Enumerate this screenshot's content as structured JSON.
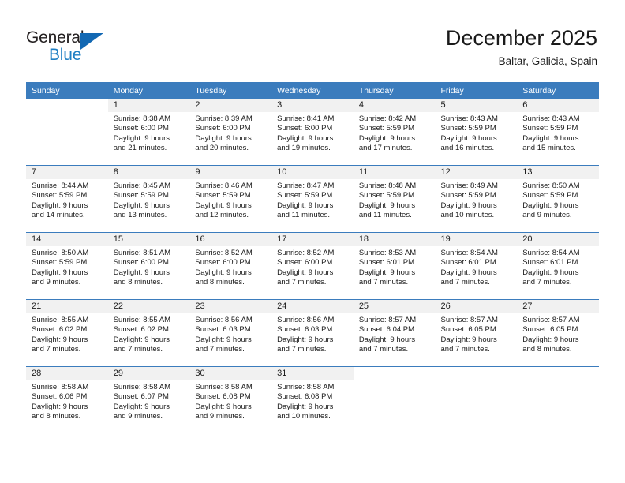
{
  "brand": {
    "name_part1": "General",
    "name_part2": "Blue",
    "triangle_icon": "triangle-icon",
    "accent_color": "#1f7fc4",
    "triangle_color": "#1268b3"
  },
  "header": {
    "title": "December 2025",
    "subtitle": "Baltar, Galicia, Spain"
  },
  "calendar": {
    "header_bg": "#3b7cbd",
    "daynum_bg": "#f1f1f1",
    "weekday_headers": [
      "Sunday",
      "Monday",
      "Tuesday",
      "Wednesday",
      "Thursday",
      "Friday",
      "Saturday"
    ],
    "weeks": [
      [
        {
          "day": "",
          "sunrise": "",
          "sunset": "",
          "daylight_line1": "",
          "daylight_line2": "",
          "blank": true
        },
        {
          "day": "1",
          "sunrise": "Sunrise: 8:38 AM",
          "sunset": "Sunset: 6:00 PM",
          "daylight_line1": "Daylight: 9 hours",
          "daylight_line2": "and 21 minutes."
        },
        {
          "day": "2",
          "sunrise": "Sunrise: 8:39 AM",
          "sunset": "Sunset: 6:00 PM",
          "daylight_line1": "Daylight: 9 hours",
          "daylight_line2": "and 20 minutes."
        },
        {
          "day": "3",
          "sunrise": "Sunrise: 8:41 AM",
          "sunset": "Sunset: 6:00 PM",
          "daylight_line1": "Daylight: 9 hours",
          "daylight_line2": "and 19 minutes."
        },
        {
          "day": "4",
          "sunrise": "Sunrise: 8:42 AM",
          "sunset": "Sunset: 5:59 PM",
          "daylight_line1": "Daylight: 9 hours",
          "daylight_line2": "and 17 minutes."
        },
        {
          "day": "5",
          "sunrise": "Sunrise: 8:43 AM",
          "sunset": "Sunset: 5:59 PM",
          "daylight_line1": "Daylight: 9 hours",
          "daylight_line2": "and 16 minutes."
        },
        {
          "day": "6",
          "sunrise": "Sunrise: 8:43 AM",
          "sunset": "Sunset: 5:59 PM",
          "daylight_line1": "Daylight: 9 hours",
          "daylight_line2": "and 15 minutes."
        }
      ],
      [
        {
          "day": "7",
          "sunrise": "Sunrise: 8:44 AM",
          "sunset": "Sunset: 5:59 PM",
          "daylight_line1": "Daylight: 9 hours",
          "daylight_line2": "and 14 minutes."
        },
        {
          "day": "8",
          "sunrise": "Sunrise: 8:45 AM",
          "sunset": "Sunset: 5:59 PM",
          "daylight_line1": "Daylight: 9 hours",
          "daylight_line2": "and 13 minutes."
        },
        {
          "day": "9",
          "sunrise": "Sunrise: 8:46 AM",
          "sunset": "Sunset: 5:59 PM",
          "daylight_line1": "Daylight: 9 hours",
          "daylight_line2": "and 12 minutes."
        },
        {
          "day": "10",
          "sunrise": "Sunrise: 8:47 AM",
          "sunset": "Sunset: 5:59 PM",
          "daylight_line1": "Daylight: 9 hours",
          "daylight_line2": "and 11 minutes."
        },
        {
          "day": "11",
          "sunrise": "Sunrise: 8:48 AM",
          "sunset": "Sunset: 5:59 PM",
          "daylight_line1": "Daylight: 9 hours",
          "daylight_line2": "and 11 minutes."
        },
        {
          "day": "12",
          "sunrise": "Sunrise: 8:49 AM",
          "sunset": "Sunset: 5:59 PM",
          "daylight_line1": "Daylight: 9 hours",
          "daylight_line2": "and 10 minutes."
        },
        {
          "day": "13",
          "sunrise": "Sunrise: 8:50 AM",
          "sunset": "Sunset: 5:59 PM",
          "daylight_line1": "Daylight: 9 hours",
          "daylight_line2": "and 9 minutes."
        }
      ],
      [
        {
          "day": "14",
          "sunrise": "Sunrise: 8:50 AM",
          "sunset": "Sunset: 5:59 PM",
          "daylight_line1": "Daylight: 9 hours",
          "daylight_line2": "and 9 minutes."
        },
        {
          "day": "15",
          "sunrise": "Sunrise: 8:51 AM",
          "sunset": "Sunset: 6:00 PM",
          "daylight_line1": "Daylight: 9 hours",
          "daylight_line2": "and 8 minutes."
        },
        {
          "day": "16",
          "sunrise": "Sunrise: 8:52 AM",
          "sunset": "Sunset: 6:00 PM",
          "daylight_line1": "Daylight: 9 hours",
          "daylight_line2": "and 8 minutes."
        },
        {
          "day": "17",
          "sunrise": "Sunrise: 8:52 AM",
          "sunset": "Sunset: 6:00 PM",
          "daylight_line1": "Daylight: 9 hours",
          "daylight_line2": "and 7 minutes."
        },
        {
          "day": "18",
          "sunrise": "Sunrise: 8:53 AM",
          "sunset": "Sunset: 6:01 PM",
          "daylight_line1": "Daylight: 9 hours",
          "daylight_line2": "and 7 minutes."
        },
        {
          "day": "19",
          "sunrise": "Sunrise: 8:54 AM",
          "sunset": "Sunset: 6:01 PM",
          "daylight_line1": "Daylight: 9 hours",
          "daylight_line2": "and 7 minutes."
        },
        {
          "day": "20",
          "sunrise": "Sunrise: 8:54 AM",
          "sunset": "Sunset: 6:01 PM",
          "daylight_line1": "Daylight: 9 hours",
          "daylight_line2": "and 7 minutes."
        }
      ],
      [
        {
          "day": "21",
          "sunrise": "Sunrise: 8:55 AM",
          "sunset": "Sunset: 6:02 PM",
          "daylight_line1": "Daylight: 9 hours",
          "daylight_line2": "and 7 minutes."
        },
        {
          "day": "22",
          "sunrise": "Sunrise: 8:55 AM",
          "sunset": "Sunset: 6:02 PM",
          "daylight_line1": "Daylight: 9 hours",
          "daylight_line2": "and 7 minutes."
        },
        {
          "day": "23",
          "sunrise": "Sunrise: 8:56 AM",
          "sunset": "Sunset: 6:03 PM",
          "daylight_line1": "Daylight: 9 hours",
          "daylight_line2": "and 7 minutes."
        },
        {
          "day": "24",
          "sunrise": "Sunrise: 8:56 AM",
          "sunset": "Sunset: 6:03 PM",
          "daylight_line1": "Daylight: 9 hours",
          "daylight_line2": "and 7 minutes."
        },
        {
          "day": "25",
          "sunrise": "Sunrise: 8:57 AM",
          "sunset": "Sunset: 6:04 PM",
          "daylight_line1": "Daylight: 9 hours",
          "daylight_line2": "and 7 minutes."
        },
        {
          "day": "26",
          "sunrise": "Sunrise: 8:57 AM",
          "sunset": "Sunset: 6:05 PM",
          "daylight_line1": "Daylight: 9 hours",
          "daylight_line2": "and 7 minutes."
        },
        {
          "day": "27",
          "sunrise": "Sunrise: 8:57 AM",
          "sunset": "Sunset: 6:05 PM",
          "daylight_line1": "Daylight: 9 hours",
          "daylight_line2": "and 8 minutes."
        }
      ],
      [
        {
          "day": "28",
          "sunrise": "Sunrise: 8:58 AM",
          "sunset": "Sunset: 6:06 PM",
          "daylight_line1": "Daylight: 9 hours",
          "daylight_line2": "and 8 minutes."
        },
        {
          "day": "29",
          "sunrise": "Sunrise: 8:58 AM",
          "sunset": "Sunset: 6:07 PM",
          "daylight_line1": "Daylight: 9 hours",
          "daylight_line2": "and 9 minutes."
        },
        {
          "day": "30",
          "sunrise": "Sunrise: 8:58 AM",
          "sunset": "Sunset: 6:08 PM",
          "daylight_line1": "Daylight: 9 hours",
          "daylight_line2": "and 9 minutes."
        },
        {
          "day": "31",
          "sunrise": "Sunrise: 8:58 AM",
          "sunset": "Sunset: 6:08 PM",
          "daylight_line1": "Daylight: 9 hours",
          "daylight_line2": "and 10 minutes."
        },
        {
          "day": "",
          "sunrise": "",
          "sunset": "",
          "daylight_line1": "",
          "daylight_line2": "",
          "blank": true
        },
        {
          "day": "",
          "sunrise": "",
          "sunset": "",
          "daylight_line1": "",
          "daylight_line2": "",
          "blank": true
        },
        {
          "day": "",
          "sunrise": "",
          "sunset": "",
          "daylight_line1": "",
          "daylight_line2": "",
          "blank": true
        }
      ]
    ]
  }
}
